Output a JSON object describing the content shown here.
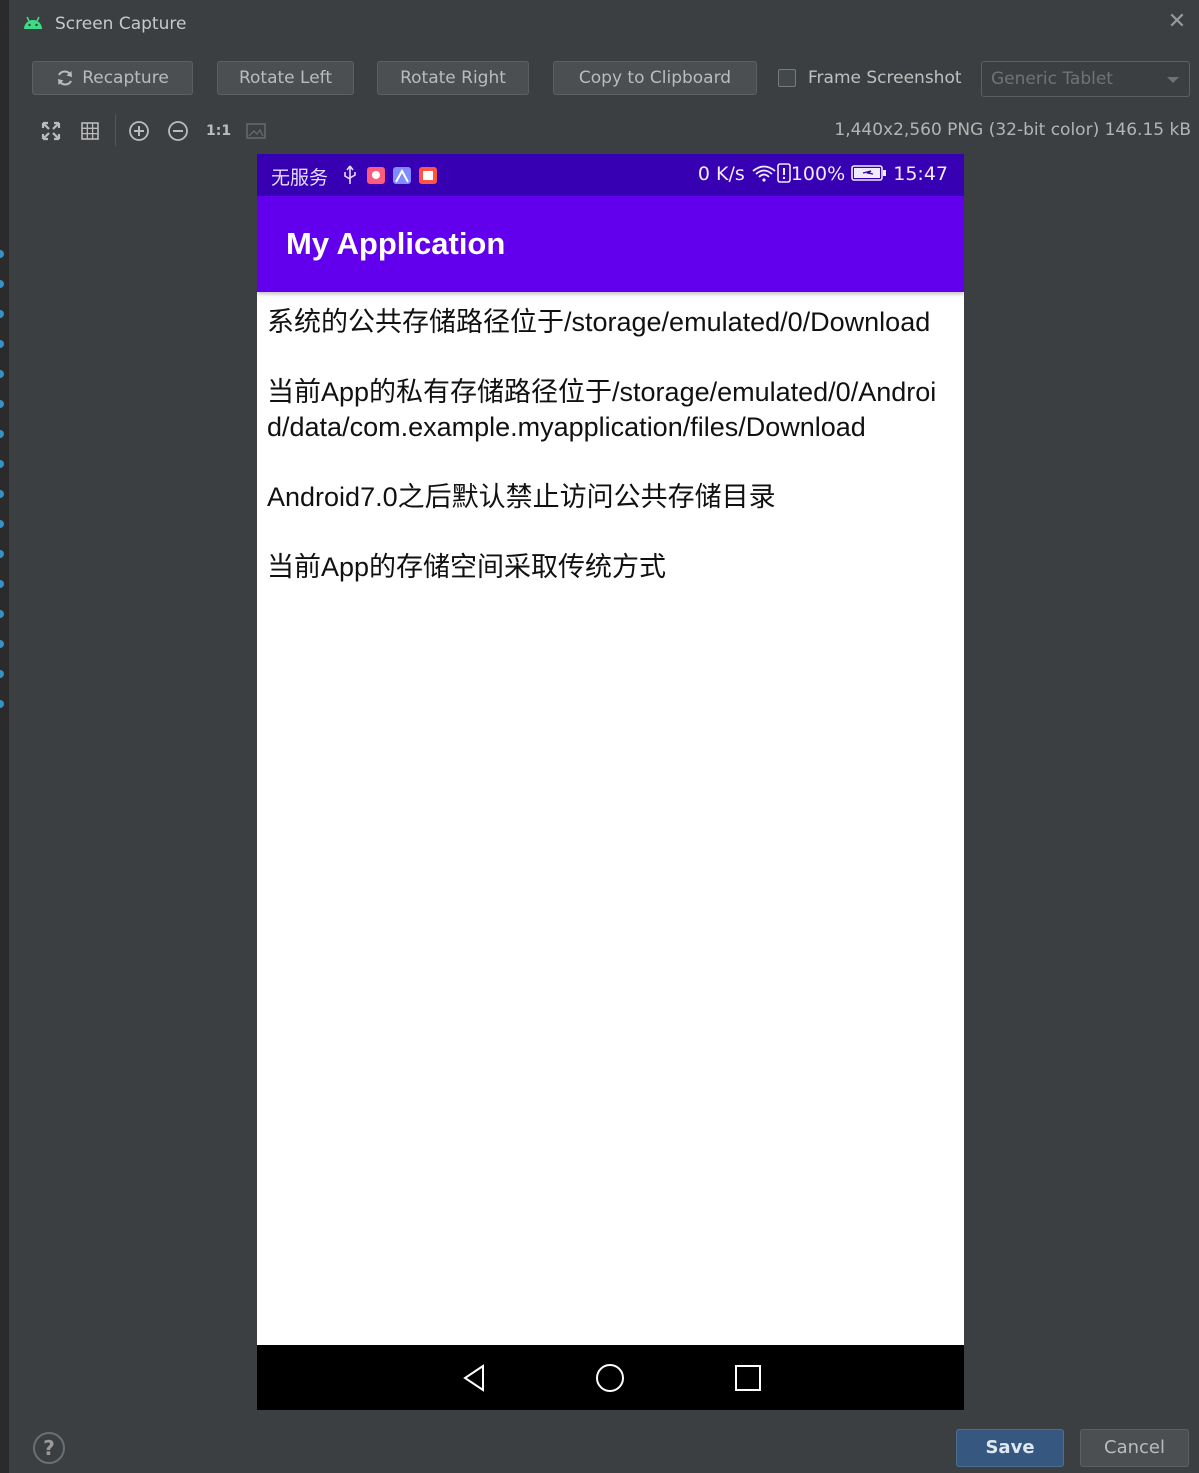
{
  "window": {
    "title": "Screen Capture"
  },
  "toolbar": {
    "recapture": "Recapture",
    "rotate_left": "Rotate Left",
    "rotate_right": "Rotate Right",
    "copy_clipboard": "Copy to Clipboard",
    "frame_screenshot": "Frame Screenshot",
    "frame_checked": false,
    "device_select": "Generic Tablet",
    "zoom_actual": "1:1"
  },
  "image_info": "1,440x2,560 PNG (32-bit color) 146.15 kB",
  "phone": {
    "status": {
      "carrier": "无服务",
      "speed": "0 K/s",
      "battery": "100%",
      "time": "15:47"
    },
    "app_title": "My Application",
    "paragraphs": [
      "系统的公共存储路径位于/storage/emulated/0/Download",
      "当前App的私有存储路径位于/storage/emulated/0/Android/data/com.example.myapplication/files/Download",
      "Android7.0之后默认禁止访问公共存储目录",
      "当前App的存储空间采取传统方式"
    ]
  },
  "footer": {
    "help": "?",
    "save": "Save",
    "cancel": "Cancel"
  },
  "colors": {
    "status_bar": "#3700b3",
    "app_bar": "#6200ee",
    "save_button": "#365880"
  }
}
